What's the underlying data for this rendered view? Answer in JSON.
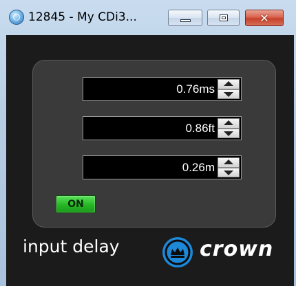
{
  "window": {
    "title": "12845 - My CDi3...",
    "icon": "app-disc-icon",
    "controls": {
      "minimize": "minimize-icon",
      "maximize": "maximize-icon",
      "close_glyph": "✕"
    }
  },
  "panel": {
    "fields": [
      {
        "value": "0.76ms"
      },
      {
        "value": "0.86ft"
      },
      {
        "value": "0.26m"
      }
    ],
    "on_button_label": "ON",
    "on_button_color": "#25b625"
  },
  "footer": {
    "label": "input delay",
    "brand": "crown",
    "brand_color": "#1e88d8"
  }
}
